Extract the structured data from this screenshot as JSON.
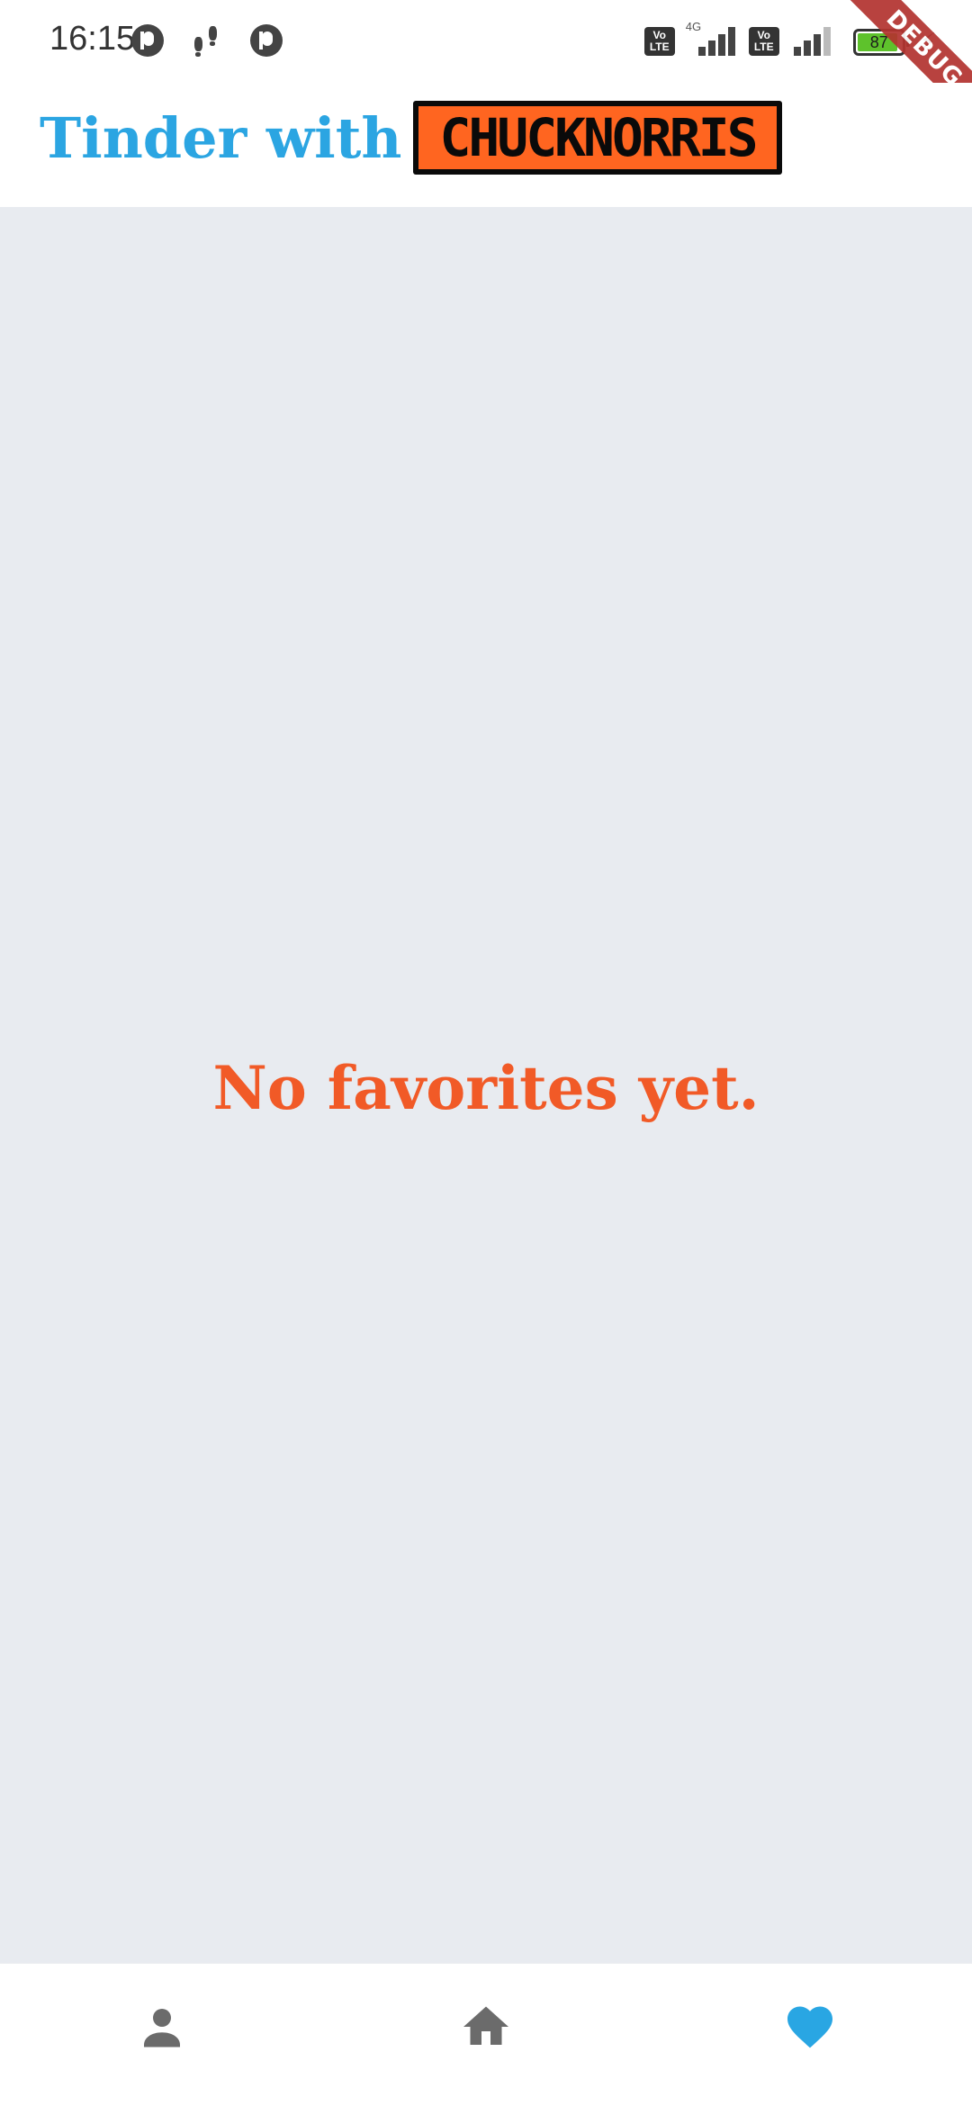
{
  "status_bar": {
    "time": "16:15",
    "network_label": "4G",
    "volte_label": "Vo LTE",
    "battery_level": "87",
    "icons": [
      "app-notification-icon",
      "steps-icon",
      "app-notification-icon",
      "volte-icon",
      "signal-icon",
      "volte-icon",
      "signal-icon",
      "battery-icon",
      "charging-bolt-icon"
    ]
  },
  "debug_banner": {
    "label": "DEBUG"
  },
  "app_bar": {
    "title": "Tinder with",
    "logo_text": "CHUCKNORRIS"
  },
  "main": {
    "empty_message": "No favorites yet."
  },
  "bottom_nav": {
    "items": [
      {
        "icon": "person-icon",
        "active": false
      },
      {
        "icon": "home-icon",
        "active": false
      },
      {
        "icon": "heart-icon",
        "active": true
      }
    ]
  },
  "colors": {
    "title_blue": "#2ba5e2",
    "message_orange": "#f15a27",
    "logo_orange": "#ff6520",
    "background_gray": "#e8ebf0",
    "inactive_icon": "#6b6b6b",
    "active_icon": "#29a6e3",
    "debug_red": "#b3332f"
  }
}
